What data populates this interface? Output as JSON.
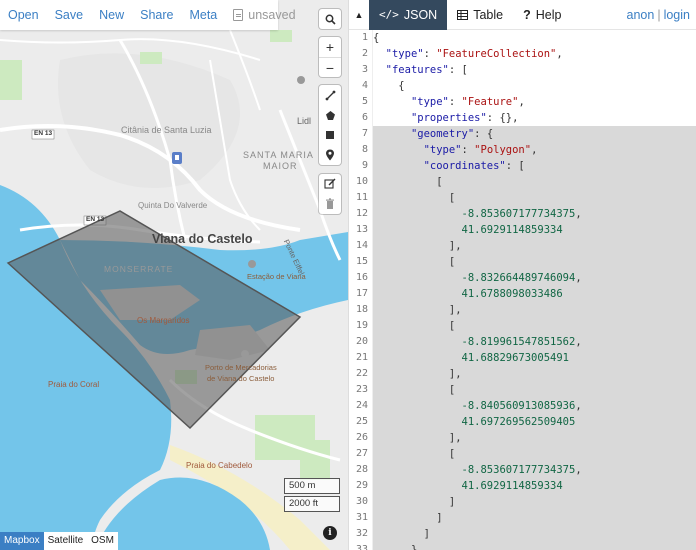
{
  "toolbar": {
    "open": "Open",
    "save": "Save",
    "new": "New",
    "share": "Share",
    "meta": "Meta",
    "status": "unsaved"
  },
  "map": {
    "labels": {
      "citania": "Citânia de Santa Luzia",
      "santa_maria": "SANTA MARIA",
      "maior": "MAIOR",
      "lidl": "Lidl",
      "quinta": "Quinta Do Valverde",
      "viana": "Viana do Castelo",
      "monserrate": "MONSERRATE",
      "estacao": "Estação de Viana",
      "ponte": "Ponte Eiffel",
      "os_margaridos": "Os Margaridos",
      "porto1": "Porto de Mercadorias",
      "porto2": "de Viana do Castelo",
      "praia_coral": "Praia do Coral",
      "praia_cabedelo": "Praia do Cabedelo",
      "en13a": "EN 13",
      "en13b": "EN 13"
    },
    "scale": {
      "metric": "500 m",
      "imperial": "2000 ft"
    },
    "layers": [
      "Mapbox",
      "Satellite",
      "OSM"
    ],
    "active_layer": "Mapbox",
    "info": "i",
    "colors": {
      "water": "#73c5ea",
      "land": "#ececec",
      "polygon": "#555555"
    }
  },
  "pane": {
    "tabs": {
      "json": "JSON",
      "table": "Table",
      "help": "Help"
    },
    "user": "anon",
    "login": "login",
    "sep": "|"
  },
  "code_lines": [
    "{",
    "  \"type\": \"FeatureCollection\",",
    "  \"features\": [",
    "    {",
    "      \"type\": \"Feature\",",
    "      \"properties\": {},",
    "      \"geometry\": {",
    "        \"type\": \"Polygon\",",
    "        \"coordinates\": [",
    "          [",
    "            [",
    "              -8.853607177734375,",
    "              41.6929114859334",
    "            ],",
    "            [",
    "              -8.832664489746094,",
    "              41.6788098033486",
    "            ],",
    "            [",
    "              -8.819961547851562,",
    "              41.68829673005491",
    "            ],",
    "            [",
    "              -8.840560913085936,",
    "              41.697269562509405",
    "            ],",
    "            [",
    "              -8.853607177734375,",
    "              41.6929114859334",
    "            ]",
    "          ]",
    "        ]",
    "      }"
  ],
  "highlight_from_line": 7
}
